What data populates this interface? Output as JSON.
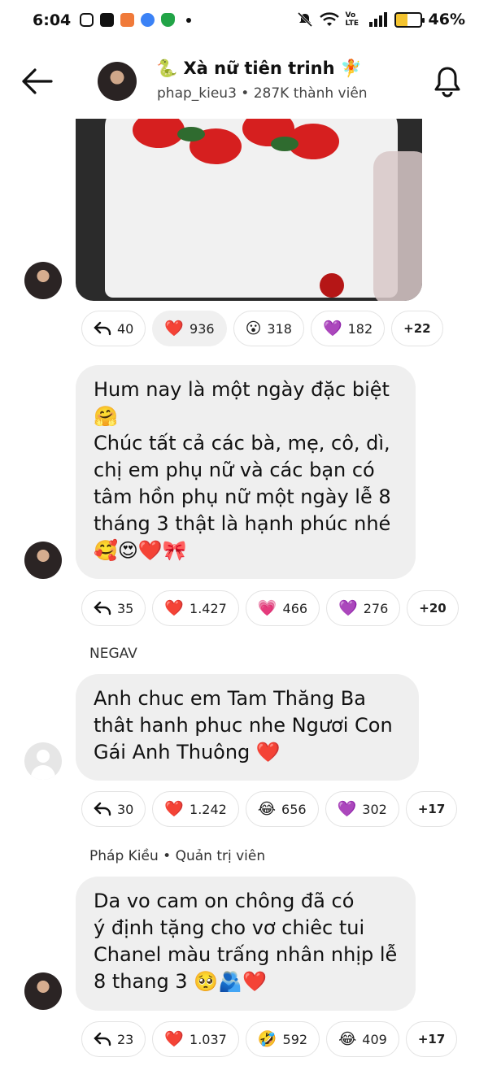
{
  "status_bar": {
    "time": "6:04",
    "battery": "46%",
    "network": "Vo LTE",
    "icons": [
      "instagram-icon",
      "shopee-icon",
      "app-icon",
      "app-icon",
      "shield-icon",
      "dot"
    ]
  },
  "header": {
    "title": "🐍 Xà nữ tiên trinh 🧚",
    "subtitle": "phap_kieu3 • 287K thành viên"
  },
  "messages": [
    {
      "reactions": [
        {
          "emoji": "",
          "count": "40",
          "kind": "reply"
        },
        {
          "emoji": "❤️",
          "count": "936",
          "active": true
        },
        {
          "emoji": "😮",
          "count": "318"
        },
        {
          "emoji": "💜",
          "count": "182"
        },
        {
          "emoji": "",
          "count": "+22",
          "kind": "more"
        }
      ]
    },
    {
      "text_lines": [
        "Hum nay là một ngày đặc biệt",
        "🤗",
        "Chúc tất cả các bà, mẹ, cô, dì,",
        "chị em phụ nữ và các bạn có",
        "tâm hồn phụ nữ một ngày lễ 8",
        "tháng 3 thật là hạnh phúc nhé",
        "🥰😍❤️🎀"
      ],
      "reactions": [
        {
          "emoji": "",
          "count": "35",
          "kind": "reply"
        },
        {
          "emoji": "❤️",
          "count": "1.427"
        },
        {
          "emoji": "💗",
          "count": "466"
        },
        {
          "emoji": "💜",
          "count": "276"
        },
        {
          "emoji": "",
          "count": "+20",
          "kind": "more"
        }
      ]
    },
    {
      "sender": "NEGAV",
      "text_lines": [
        "Anh chuc em Tam Thăng Ba",
        "thât hanh phuc nhe Ngươi Con",
        "Gái Anh Thuông ❤️"
      ],
      "reactions": [
        {
          "emoji": "",
          "count": "30",
          "kind": "reply"
        },
        {
          "emoji": "❤️",
          "count": "1.242"
        },
        {
          "emoji": "😂",
          "count": "656"
        },
        {
          "emoji": "💜",
          "count": "302"
        },
        {
          "emoji": "",
          "count": "+17",
          "kind": "more"
        }
      ]
    },
    {
      "sender": "Pháp Kiều • Quản trị viên",
      "text_lines": [
        "Da vo cam on chông đã có",
        "ý định tặng cho vơ chiêc tui",
        "Chanel màu trấng nhân nhịp lễ",
        "8 thang 3 🥺🫂❤️"
      ],
      "reactions": [
        {
          "emoji": "",
          "count": "23",
          "kind": "reply"
        },
        {
          "emoji": "❤️",
          "count": "1.037"
        },
        {
          "emoji": "🤣",
          "count": "592"
        },
        {
          "emoji": "😂",
          "count": "409"
        },
        {
          "emoji": "",
          "count": "+17",
          "kind": "more"
        }
      ]
    }
  ]
}
